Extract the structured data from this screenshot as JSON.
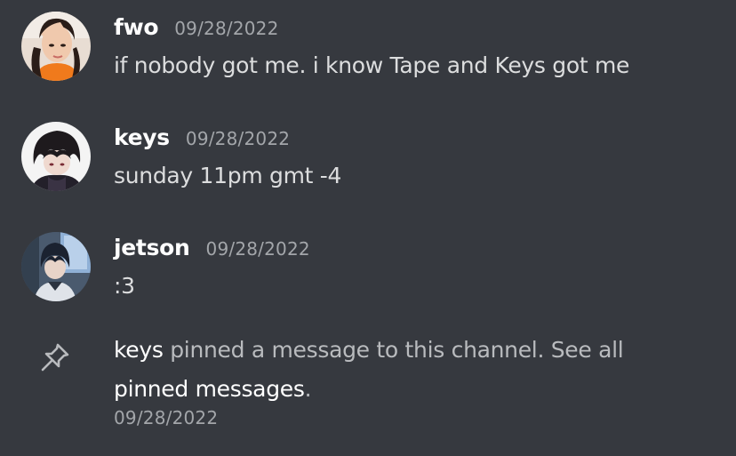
{
  "messages": [
    {
      "author": "fwo",
      "timestamp": "09/28/2022",
      "content": "if nobody got me. i know Tape and Keys got me"
    },
    {
      "author": "keys",
      "timestamp": "09/28/2022",
      "content": "sunday 11pm gmt -4"
    },
    {
      "author": "jetson",
      "timestamp": "09/28/2022",
      "content": ":3"
    }
  ],
  "system_message": {
    "icon": "pin-icon",
    "actor": "keys",
    "text_before_link": " pinned a message to this channel. See all ",
    "link_text": "pinned messages",
    "text_after_link": ".",
    "timestamp": "09/28/2022"
  },
  "colors": {
    "background": "#36393f",
    "username": "#ffffff",
    "message_text": "#dcddde",
    "timestamp": "#a3a6aa",
    "system_text": "#b9bbbe"
  }
}
